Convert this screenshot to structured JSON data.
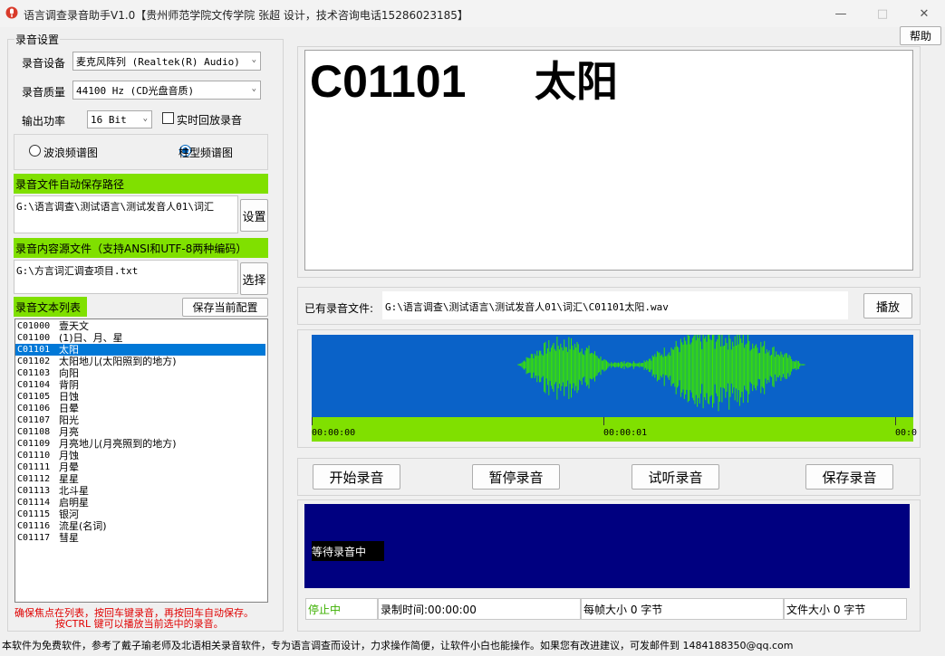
{
  "window": {
    "title": "语言调查录音助手V1.0【贵州师范学院文传学院 张超 设计，技术咨询电话15286023185】",
    "help_label": "帮助"
  },
  "settings": {
    "group_title": "录音设置",
    "device_label": "录音设备",
    "device_value": "麦克风阵列 (Realtek(R) Audio)",
    "quality_label": "录音质量",
    "quality_value": "44100 Hz (CD光盘音质)",
    "power_label": "输出功率",
    "power_value": "16 Bit",
    "playback_label": "实时回放录音"
  },
  "spectrum": {
    "wave_label": "波浪频谱图",
    "bar_label": "柱型频谱图"
  },
  "save_path": {
    "header": "录音文件自动保存路径",
    "value": "G:\\语言调查\\测试语言\\测试发音人01\\词汇",
    "button": "设置"
  },
  "source_file": {
    "header": "录音内容源文件（支持ANSI和UTF-8两种编码）",
    "value": "G:\\方言词汇调查项目.txt",
    "button": "选择"
  },
  "list": {
    "header": "录音文本列表",
    "save_config_button": "保存当前配置",
    "items": [
      {
        "code": "C01000",
        "text": "壹天文"
      },
      {
        "code": "C01100",
        "text": "(1)日、月、星"
      },
      {
        "code": "C01101",
        "text": "太阳"
      },
      {
        "code": "C01102",
        "text": "太阳地儿(太阳照到的地方)"
      },
      {
        "code": "C01103",
        "text": "向阳"
      },
      {
        "code": "C01104",
        "text": "背阴"
      },
      {
        "code": "C01105",
        "text": "日蚀"
      },
      {
        "code": "C01106",
        "text": "日晕"
      },
      {
        "code": "C01107",
        "text": "阳光"
      },
      {
        "code": "C01108",
        "text": "月亮"
      },
      {
        "code": "C01109",
        "text": "月亮地儿(月亮照到的地方)"
      },
      {
        "code": "C01110",
        "text": "月蚀"
      },
      {
        "code": "C01111",
        "text": "月晕"
      },
      {
        "code": "C01112",
        "text": "星星"
      },
      {
        "code": "C01113",
        "text": "北斗星"
      },
      {
        "code": "C01114",
        "text": "启明星"
      },
      {
        "code": "C01115",
        "text": "银河"
      },
      {
        "code": "C01116",
        "text": "流星(名词)"
      },
      {
        "code": "C01117",
        "text": "彗星"
      }
    ],
    "selected_index": 2,
    "hint_line1": "确保焦点在列表，按回车键录音，再按回车自动保存。",
    "hint_line2": "按CTRL 键可以播放当前选中的录音。"
  },
  "display": {
    "code": "C01101",
    "word": "太阳"
  },
  "recorded": {
    "label": "已有录音文件:",
    "path": "G:\\语言调查\\测试语言\\测试发音人01\\词汇\\C01101太阳.wav",
    "play_button": "播放"
  },
  "timeline": {
    "t0": "00:00:00",
    "t1": "00:00:01",
    "t2": "00:0"
  },
  "controls": {
    "start": "开始录音",
    "pause": "暂停录音",
    "listen": "试听录音",
    "save": "保存录音"
  },
  "status": {
    "message": "等待录音中",
    "state": "停止中",
    "rec_time": "录制时间:00:00:00",
    "frame_size": "每帧大小 0 字节",
    "file_size": "文件大小 0 字节"
  },
  "footer": "本软件为免费软件，参考了戴子瑜老师及北语相关录音软件，专为语言调查而设计，力求操作简便，让软件小白也能操作。如果您有改进建议，可发邮件到 1484188350@qq.com",
  "colors": {
    "accent_green": "#80e000",
    "waveform_blue": "#0a62c8",
    "status_navy": "#000080",
    "selection_blue": "#0078d7",
    "hint_red": "#e00000"
  }
}
